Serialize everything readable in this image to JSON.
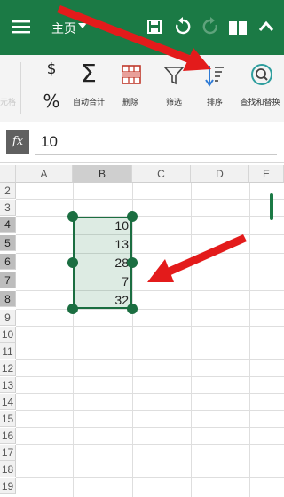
{
  "appbar": {
    "tab_label": "主页",
    "bg_color": "#1b7a45"
  },
  "ribbon": {
    "items": [
      {
        "label": "元格"
      },
      {
        "label": ""
      },
      {
        "label": "自动合计"
      },
      {
        "label": "删除"
      },
      {
        "label": "筛选"
      },
      {
        "label": "排序"
      },
      {
        "label": "查找和替换"
      }
    ],
    "currency_symbol": "$",
    "percent_symbol": "%",
    "sum_symbol": "Σ"
  },
  "formula_bar": {
    "fx_label": "fx",
    "value": "10"
  },
  "sheet": {
    "columns": [
      "A",
      "B",
      "C",
      "D",
      "E"
    ],
    "rows": [
      "2",
      "3",
      "4",
      "5",
      "6",
      "7",
      "8",
      "9",
      "10",
      "11",
      "12",
      "13",
      "14",
      "15",
      "16",
      "17",
      "18",
      "19"
    ],
    "selected_column": "B",
    "selected_rows": [
      "4",
      "5",
      "6",
      "7",
      "8"
    ],
    "cells_B": [
      "10",
      "13",
      "28",
      "7",
      "32"
    ]
  },
  "colors": {
    "selection_border": "#1b6e41",
    "arrow": "#e31b1b"
  }
}
